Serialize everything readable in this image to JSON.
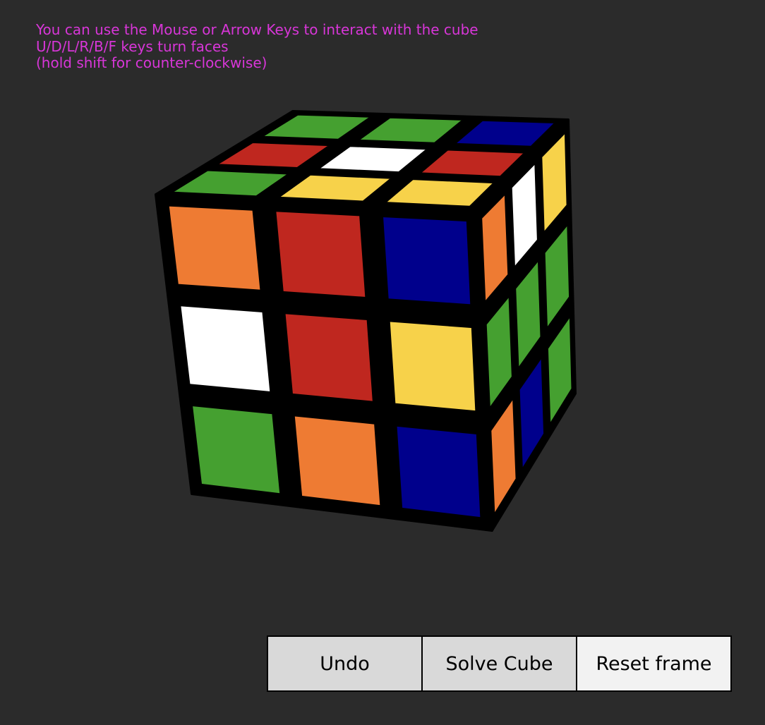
{
  "instructions": {
    "line1": "You can use the Mouse or Arrow Keys to interact with the cube",
    "line2": "U/D/L/R/B/F keys turn faces",
    "line3": "(hold shift for counter-clockwise)"
  },
  "colors": {
    "background": "#2b2b2b",
    "instruction_text": "#d836d8",
    "green": "#45a030",
    "red": "#bf271f",
    "white": "#ffffff",
    "blue": "#00008c",
    "yellow": "#f7d24a",
    "orange": "#ee7b33"
  },
  "cube": {
    "top": [
      [
        "green",
        "green",
        "blue"
      ],
      [
        "red",
        "white",
        "red"
      ],
      [
        "green",
        "yellow",
        "yellow"
      ]
    ],
    "front": [
      [
        "orange",
        "red",
        "blue"
      ],
      [
        "white",
        "red",
        "yellow"
      ],
      [
        "green",
        "orange",
        "blue"
      ]
    ],
    "right": [
      [
        "orange",
        "white",
        "yellow"
      ],
      [
        "green",
        "green",
        "green"
      ],
      [
        "orange",
        "blue",
        "green"
      ]
    ]
  },
  "buttons": {
    "undo": "Undo",
    "solve": "Solve Cube",
    "reset": "Reset frame"
  }
}
